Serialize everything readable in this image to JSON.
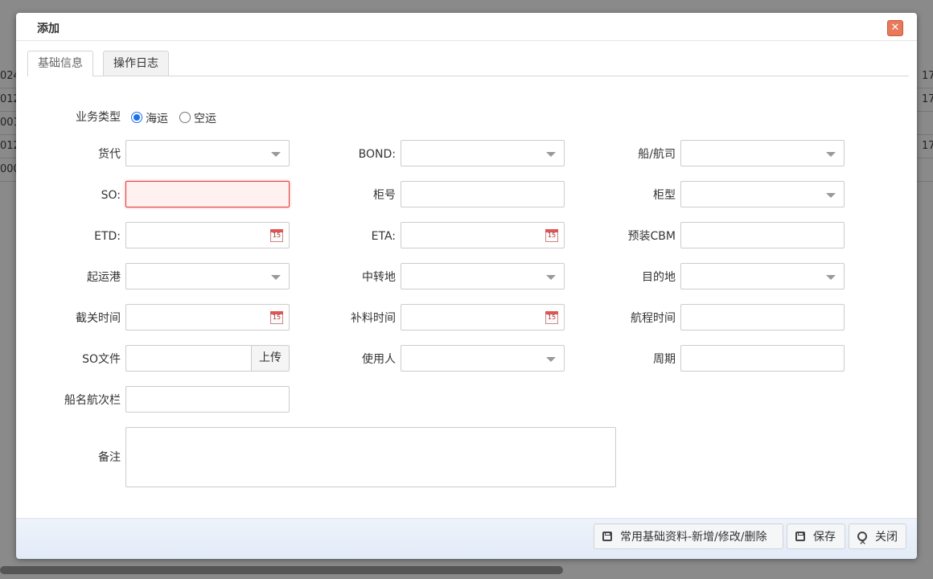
{
  "background": {
    "rows_left": [
      "024",
      "012",
      "001",
      "012",
      "000"
    ],
    "rows_right": [
      "17",
      "17",
      "",
      "17",
      ""
    ]
  },
  "dialog": {
    "title": "添加",
    "close_icon": "close-icon"
  },
  "tabs": [
    {
      "label": "基础信息",
      "active": true
    },
    {
      "label": "操作日志",
      "active": false
    }
  ],
  "form": {
    "business_type": {
      "label": "业务类型",
      "options": [
        "海运",
        "空运"
      ],
      "selected": "海运"
    },
    "forwarder": {
      "label": "货代",
      "value": ""
    },
    "bond": {
      "label": "BOND:",
      "value": ""
    },
    "carrier": {
      "label": "船/航司",
      "value": ""
    },
    "so": {
      "label": "SO:",
      "value": ""
    },
    "container_no": {
      "label": "柜号",
      "value": ""
    },
    "container_type": {
      "label": "柜型",
      "value": ""
    },
    "etd": {
      "label": "ETD:",
      "value": ""
    },
    "eta": {
      "label": "ETA:",
      "value": ""
    },
    "cbm": {
      "label": "预装CBM",
      "value": ""
    },
    "pol": {
      "label": "起运港",
      "value": ""
    },
    "transit": {
      "label": "中转地",
      "value": ""
    },
    "destination": {
      "label": "目的地",
      "value": ""
    },
    "cutoff": {
      "label": "截关时间",
      "value": ""
    },
    "supplement": {
      "label": "补料时间",
      "value": ""
    },
    "voyage_time": {
      "label": "航程时间",
      "value": ""
    },
    "so_file": {
      "label": "SO文件",
      "value": "",
      "upload": "上传"
    },
    "user": {
      "label": "使用人",
      "value": ""
    },
    "period": {
      "label": "周期",
      "value": ""
    },
    "vessel": {
      "label": "船名航次栏",
      "value": ""
    },
    "remark": {
      "label": "备注",
      "value": ""
    }
  },
  "footer": {
    "basic_data_button": "常用基础资料-新增/修改/删除",
    "save_button": "保存",
    "close_button": "关闭"
  }
}
